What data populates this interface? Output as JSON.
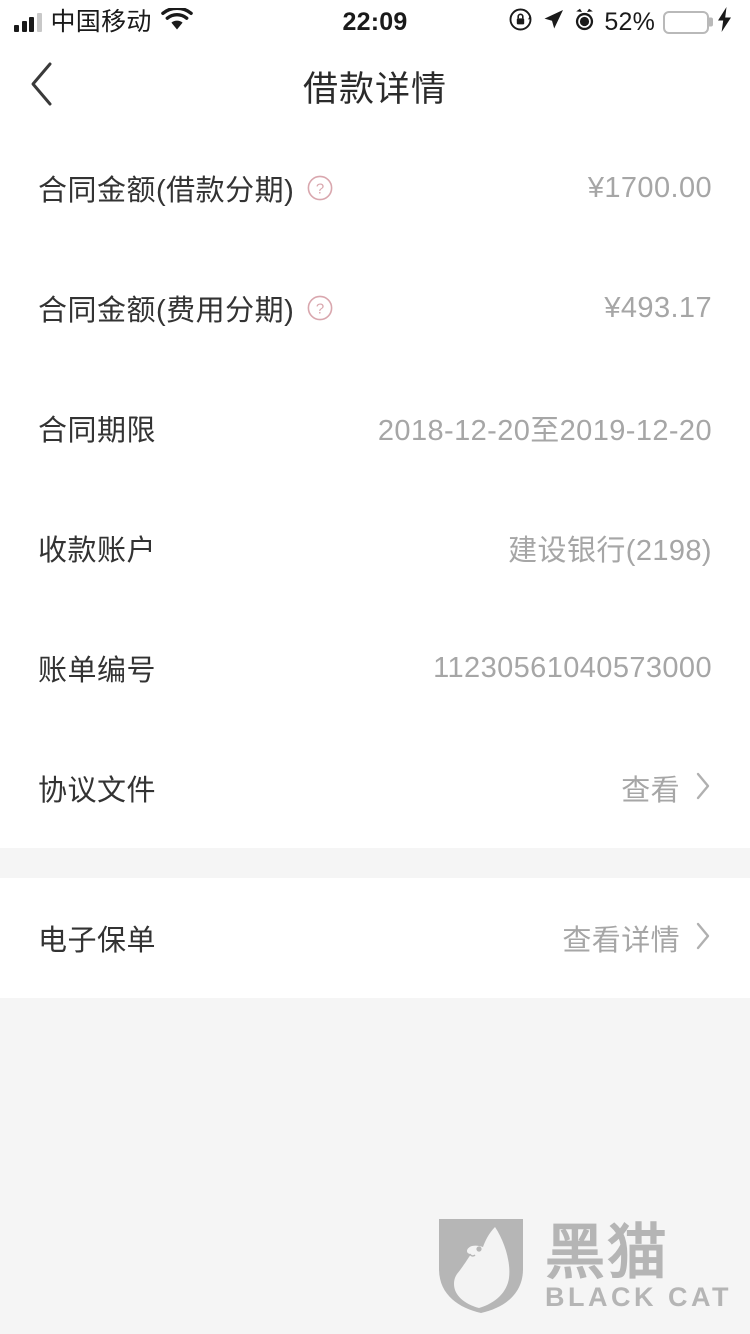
{
  "status_bar": {
    "carrier": "中国移动",
    "time": "22:09",
    "battery_percent": "52%",
    "battery_level": 52,
    "signal_bars": 3,
    "icons": {
      "signal": "signal-bars-icon",
      "wifi": "wifi-icon",
      "rotation_lock": "rotation-lock-icon",
      "location": "location-arrow-icon",
      "alarm": "alarm-clock-icon",
      "battery": "battery-icon",
      "charging": "lightning-bolt-icon"
    },
    "colors": {
      "battery_fill": "#fdc92b",
      "text": "#1a1a1a"
    }
  },
  "nav": {
    "title": "借款详情",
    "back_icon": "chevron-left-icon"
  },
  "details": {
    "rows": [
      {
        "label": "合同金额(借款分期)",
        "value": "¥1700.00",
        "has_help": true,
        "name": "contract-amount-loan-installment"
      },
      {
        "label": "合同金额(费用分期)",
        "value": "¥493.17",
        "has_help": true,
        "name": "contract-amount-fee-installment"
      },
      {
        "label": "合同期限",
        "value": "2018-12-20至2019-12-20",
        "has_help": false,
        "name": "contract-term"
      },
      {
        "label": "收款账户",
        "value": "建设银行(2198)",
        "has_help": false,
        "name": "receiving-account"
      },
      {
        "label": "账单编号",
        "value": "11230561040573000",
        "has_help": false,
        "name": "bill-number"
      },
      {
        "label": "协议文件",
        "value": "查看",
        "has_help": false,
        "has_chevron": true,
        "name": "agreement-files"
      }
    ],
    "insurance_row": {
      "label": "电子保单",
      "value": "查看详情",
      "name": "electronic-policy"
    }
  },
  "watermark": {
    "cn": "黑猫",
    "en": "BLACK CAT",
    "shield_icon": "black-cat-shield-logo"
  },
  "colors": {
    "label": "#333333",
    "value": "#a6a6a6",
    "divider": "#f5f5f5",
    "help_icon": "#d9a7ae",
    "background": "#ffffff"
  }
}
